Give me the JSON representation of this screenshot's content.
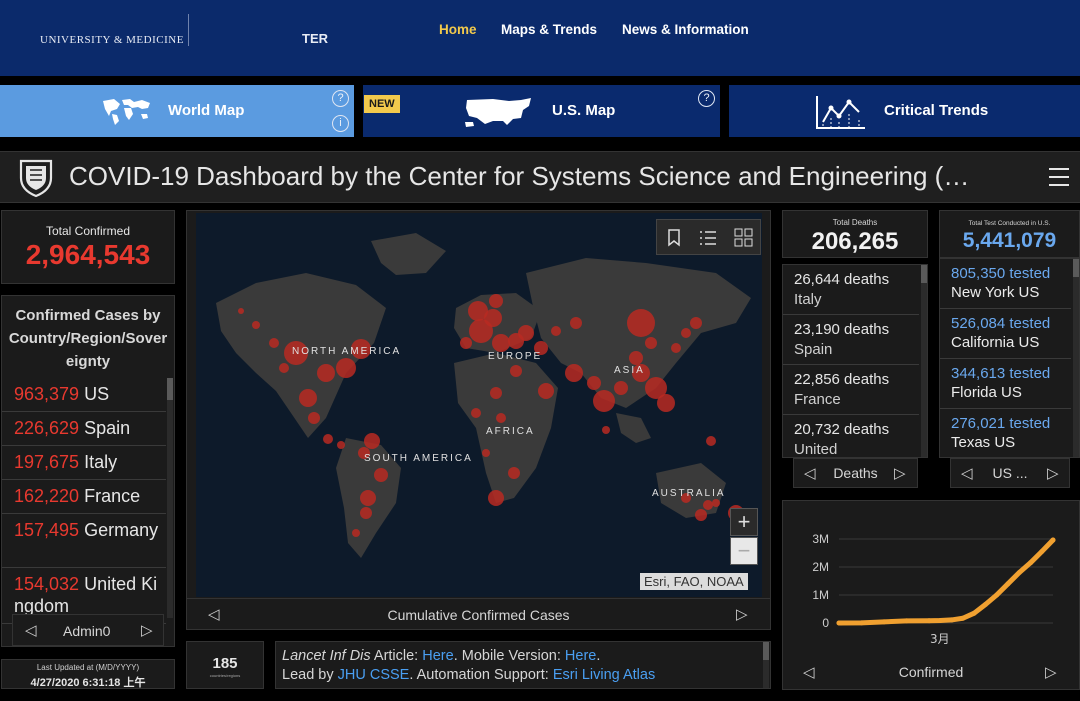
{
  "topnav": {
    "logo_text": "UNIVERSITY & MEDICINE",
    "logo_partial": "TER",
    "links": [
      "Home",
      "Maps & Trends",
      "News & Information"
    ]
  },
  "maptabs": {
    "world": "World Map",
    "us": "U.S. Map",
    "us_badge": "NEW",
    "trends": "Critical Trends"
  },
  "header": {
    "title": "COVID-19 Dashboard by the Center for Systems Science and Engineering (…"
  },
  "total_confirmed": {
    "label": "Total Confirmed",
    "value": "2,964,543"
  },
  "confirmed_by_country": {
    "title": "Confirmed Cases by Country/Region/Sovereignty",
    "rows": [
      {
        "count": "963,379",
        "name": "US"
      },
      {
        "count": "226,629",
        "name": "Spain"
      },
      {
        "count": "197,675",
        "name": "Italy"
      },
      {
        "count": "162,220",
        "name": "France"
      },
      {
        "count": "157,495",
        "name": "Germany"
      },
      {
        "count": "154,032",
        "name": "United Kingdom"
      }
    ],
    "footer": "Admin0"
  },
  "last_updated": {
    "label": "Last Updated at (M/D/YYYY)",
    "value": "4/27/2020 6:31:18 上午"
  },
  "map": {
    "continents": [
      "NORTH AMERICA",
      "EUROPE",
      "ASIA",
      "AFRICA",
      "SOUTH AMERICA",
      "AUSTRALIA"
    ],
    "attribution": "Esri, FAO, NOAA",
    "caption": "Cumulative Confirmed Cases",
    "zoom_in": "+",
    "zoom_out": "−"
  },
  "countries_count": {
    "value": "185",
    "label": "countries/regions"
  },
  "info": {
    "line1_italic": "Lancet Inf Dis",
    "line1_a": " Article: ",
    "line1_link1": "Here",
    "line1_b": ". Mobile Version: ",
    "line1_link2": "Here",
    "line1_c": ".",
    "line2_a": "Lead by ",
    "line2_link1": "JHU CSSE",
    "line2_b": ". Automation Support: ",
    "line2_link2": "Esri Living Atlas"
  },
  "deaths": {
    "label": "Total Deaths",
    "value": "206,265",
    "rows": [
      {
        "line1": "26,644 deaths",
        "line2": "Italy"
      },
      {
        "line1": "23,190 deaths",
        "line2": "Spain"
      },
      {
        "line1": "22,856 deaths",
        "line2": "France"
      },
      {
        "line1": "20,732 deaths",
        "line2": "United"
      }
    ],
    "footer": "Deaths"
  },
  "tests": {
    "label": "Total Test Conducted in U.S.",
    "value": "5,441,079",
    "rows": [
      {
        "line1": "805,350 tested",
        "line2": "New York US"
      },
      {
        "line1": "526,084 tested",
        "line2": "California US"
      },
      {
        "line1": "344,613 tested",
        "line2": "Florida US"
      },
      {
        "line1": "276,021 tested",
        "line2": "Texas US"
      }
    ],
    "footer": "US ..."
  },
  "chart_data": {
    "type": "line",
    "title": "",
    "xlabel": "",
    "ylabel": "",
    "x_ticks": [
      "3月"
    ],
    "y_ticks": [
      "0",
      "1M",
      "2M",
      "3M"
    ],
    "ylim": [
      0,
      3000000
    ],
    "x": [
      0,
      10,
      20,
      30,
      40,
      45,
      50,
      55,
      60,
      65,
      70,
      75,
      80,
      85,
      90,
      95
    ],
    "series": [
      {
        "values": [
          0,
          5000,
          40000,
          75000,
          80000,
          90000,
          110000,
          170000,
          350000,
          660000,
          1000000,
          1400000,
          1800000,
          2150000,
          2550000,
          2964543
        ]
      }
    ],
    "footer": "Confirmed",
    "colors": {
      "line": "#f0a030"
    }
  },
  "colors": {
    "nav_bg": "#0b2a6b",
    "tab_active": "#5b9be0",
    "tab_bg": "#0a2a6e",
    "accent_red": "#e8392f",
    "accent_blue": "#6aa8ee",
    "nav_active": "#f2c94c"
  }
}
